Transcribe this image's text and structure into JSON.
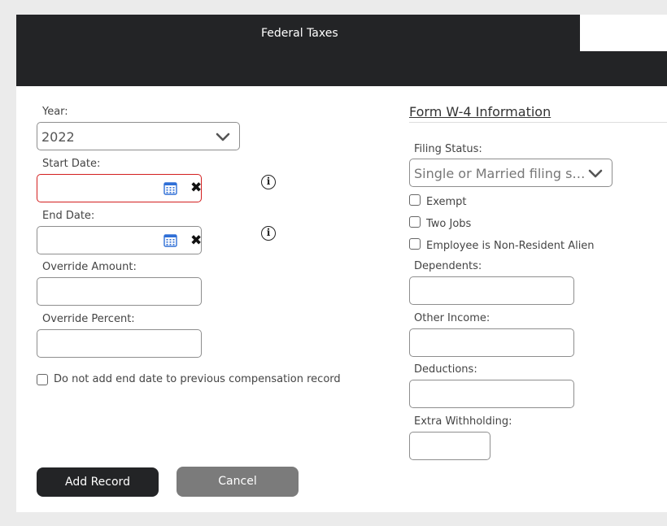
{
  "header": {
    "title": "Federal Taxes"
  },
  "form": {
    "year": {
      "label": "Year:",
      "value": "2022"
    },
    "start_date": {
      "label": "Start Date:",
      "value": ""
    },
    "end_date": {
      "label": "End Date:",
      "value": ""
    },
    "override_amount": {
      "label": "Override Amount:",
      "value": ""
    },
    "override_percent": {
      "label": "Override Percent:",
      "value": ""
    },
    "no_end_date": {
      "label": "Do not add end date to previous compensation record",
      "checked": false
    }
  },
  "w4": {
    "title": "Form W-4 Information",
    "filing_status": {
      "label": "Filing Status:",
      "value": "Single or Married filing s…"
    },
    "exempt": {
      "label": "Exempt",
      "checked": false
    },
    "two_jobs": {
      "label": "Two Jobs",
      "checked": false
    },
    "nonresident": {
      "label": "Employee is Non-Resident Alien",
      "checked": false
    },
    "dependents": {
      "label": "Dependents:",
      "value": ""
    },
    "other_income": {
      "label": "Other Income:",
      "value": ""
    },
    "deductions": {
      "label": "Deductions:",
      "value": ""
    },
    "extra_withholding": {
      "label": "Extra Withholding:",
      "value": ""
    }
  },
  "buttons": {
    "add": "Add Record",
    "cancel": "Cancel"
  },
  "icons": {
    "calendar": "calendar-icon",
    "clear": "clear-icon",
    "info": "info-icon",
    "chevron": "chevron-down-icon"
  },
  "colors": {
    "header_bg": "#232426",
    "error_border": "#d31f1f",
    "primary_button": "#232426",
    "secondary_button": "#7b7b7b",
    "calendar_blue": "#2f6fd6"
  }
}
